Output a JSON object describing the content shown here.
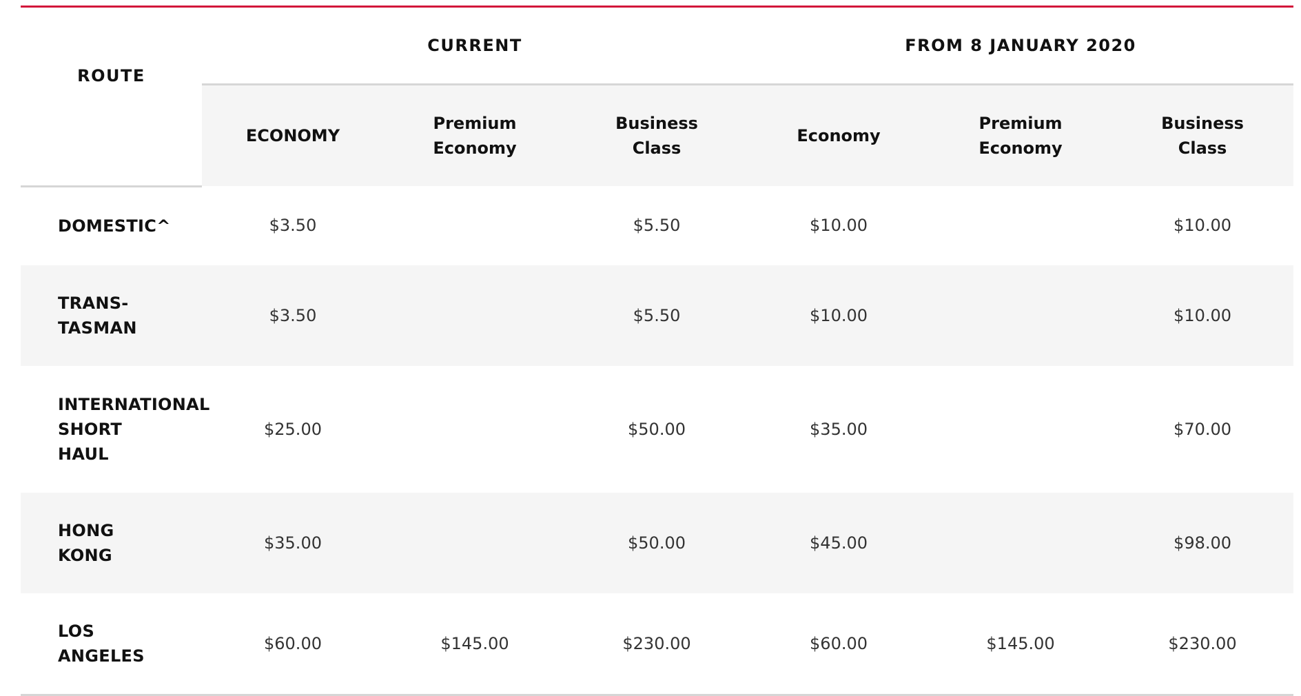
{
  "header": {
    "route": "ROUTE",
    "group_current": "CURRENT",
    "group_future": "FROM 8 JANUARY 2020",
    "current_classes": [
      [
        "ECONOMY"
      ],
      [
        "Premium",
        "Economy"
      ],
      [
        "Business",
        "Class"
      ]
    ],
    "future_classes": [
      [
        "Economy"
      ],
      [
        "Premium",
        "Economy"
      ],
      [
        "Business",
        "Class"
      ]
    ]
  },
  "rows": [
    {
      "route_lines": [
        "DOMESTIC^"
      ],
      "values": [
        "$3.50",
        "",
        "$5.50",
        "$10.00",
        "",
        "$10.00"
      ]
    },
    {
      "route_lines": [
        "TRANS-",
        "TASMAN"
      ],
      "values": [
        "$3.50",
        "",
        "$5.50",
        "$10.00",
        "",
        "$10.00"
      ]
    },
    {
      "route_lines": [
        "INTERNATIONAL",
        "SHORT",
        "HAUL"
      ],
      "values": [
        "$25.00",
        "",
        "$50.00",
        "$35.00",
        "",
        "$70.00"
      ]
    },
    {
      "route_lines": [
        "HONG",
        "KONG"
      ],
      "values": [
        "$35.00",
        "",
        "$50.00",
        "$45.00",
        "",
        "$98.00"
      ]
    },
    {
      "route_lines": [
        "LOS",
        "ANGELES"
      ],
      "values": [
        "$60.00",
        "$145.00",
        "$230.00",
        "$60.00",
        "$145.00",
        "$230.00"
      ]
    }
  ],
  "colors": {
    "accent_rule": "#d2143a",
    "shaded_row": "#f5f5f5",
    "divider": "#d6d6d6"
  }
}
